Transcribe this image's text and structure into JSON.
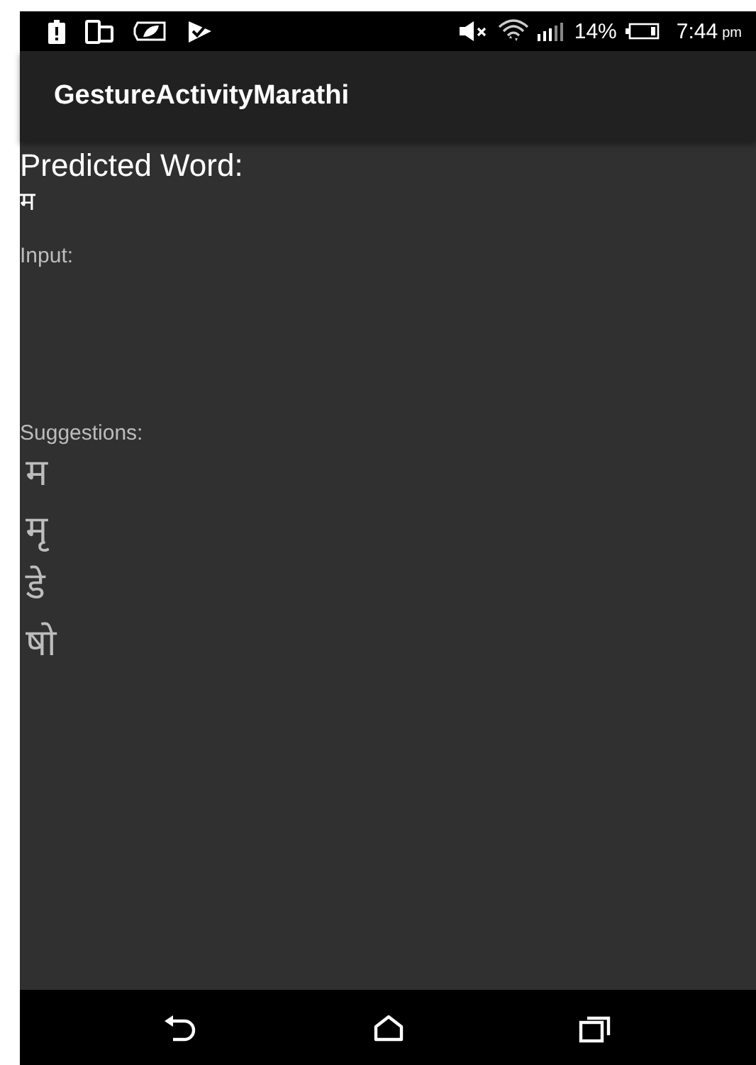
{
  "status_bar": {
    "battery_percent": "14%",
    "time": "7:44",
    "ampm": "pm"
  },
  "app_bar": {
    "title": "GestureActivityMarathi"
  },
  "predicted": {
    "label": "Predicted Word:",
    "value": "म"
  },
  "input": {
    "label": "Input:"
  },
  "suggestions": {
    "label": "Suggestions:",
    "items": [
      "म",
      "मृ",
      "डे",
      "षो"
    ]
  }
}
